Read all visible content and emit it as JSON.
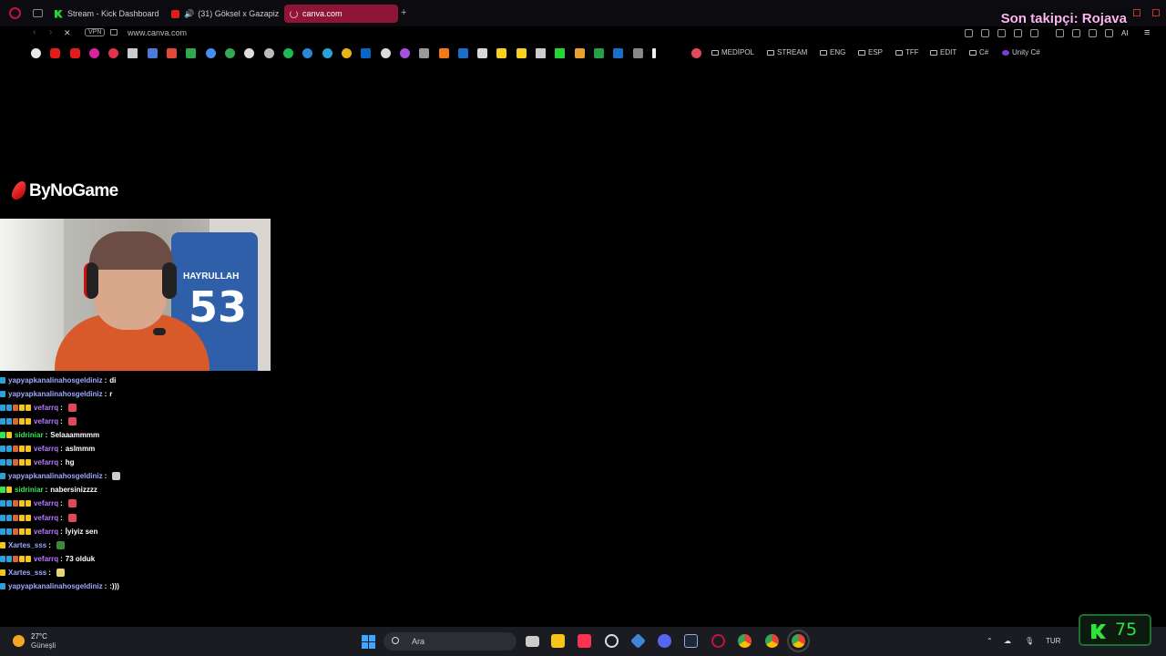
{
  "tabs": [
    {
      "label": "Stream - Kick Dashboard"
    },
    {
      "label": "(31) Göksel x Gazapizm"
    },
    {
      "label": "canva.com"
    }
  ],
  "overlay": {
    "follower_text": "Son takipçi: Rojava",
    "brand": "ByNoGame"
  },
  "address": {
    "vpn_label": "VPN",
    "url": "www.canva.com",
    "ai_label": "AI"
  },
  "bookmarks": {
    "folders": [
      "MEDİPOL",
      "STREAM",
      "ENG",
      "ESP",
      "TFF",
      "EDIT",
      "C#",
      "Unity C#"
    ]
  },
  "webcam": {
    "jersey_name": "HAYRULLAH",
    "jersey_number": "53"
  },
  "chat": [
    {
      "user": "yapyapkanalinahosgeldiniz",
      "sep": ":",
      "text": "di",
      "color": "#9ea9ff"
    },
    {
      "user": "yapyapkanalinahosgeldiniz",
      "sep": ":",
      "text": "r",
      "color": "#9ea9ff"
    },
    {
      "user": "vefarrq",
      "sep": ":",
      "text": "",
      "color": "#b57bff",
      "emote": "#e0495b"
    },
    {
      "user": "vefarrq",
      "sep": ":",
      "text": "",
      "color": "#b57bff",
      "emote": "#e0495b"
    },
    {
      "user": "sidriniar",
      "sep": ":",
      "text": "Selaaammmm",
      "color": "#35e45a"
    },
    {
      "user": "vefarrq",
      "sep": ":",
      "text": "aslmmm",
      "color": "#b57bff"
    },
    {
      "user": "vefarrq",
      "sep": ":",
      "text": "hg",
      "color": "#b57bff"
    },
    {
      "user": "yapyapkanalinahosgeldiniz",
      "sep": ":",
      "text": "",
      "color": "#9ea9ff",
      "emote": "#cccccc"
    },
    {
      "user": "sidriniar",
      "sep": ":",
      "text": "nabersinizzzz",
      "color": "#35e45a"
    },
    {
      "user": "vefarrq",
      "sep": ":",
      "text": "",
      "color": "#b57bff",
      "emote": "#e0495b"
    },
    {
      "user": "vefarrq",
      "sep": ":",
      "text": "",
      "color": "#b57bff",
      "emote": "#e0495b"
    },
    {
      "user": "vefarrq",
      "sep": ":",
      "text": "İyiyiz sen",
      "color": "#b57bff"
    },
    {
      "user": "Xartes_sss",
      "sep": ":",
      "text": "",
      "color": "#9ea9ff",
      "emote": "#3a8a3a"
    },
    {
      "user": "vefarrq",
      "sep": ":",
      "text": "73 olduk",
      "color": "#b57bff"
    },
    {
      "user": "Xartes_sss",
      "sep": ":",
      "text": "",
      "color": "#9ea9ff",
      "emote": "#e8d27a"
    },
    {
      "user": "yapyapkanalinahosgeldiniz",
      "sep": ":",
      "text": ":)))",
      "color": "#9ea9ff"
    }
  ],
  "taskbar": {
    "temperature": "27°C",
    "condition": "Güneşli",
    "search_placeholder": "Ara",
    "language": "TUR"
  },
  "kick": {
    "viewer_count": "75"
  },
  "colors": {
    "accent_tab": "#8e1438",
    "kick_green": "#2ee53c",
    "follower_pink": "#ffb6f0"
  }
}
